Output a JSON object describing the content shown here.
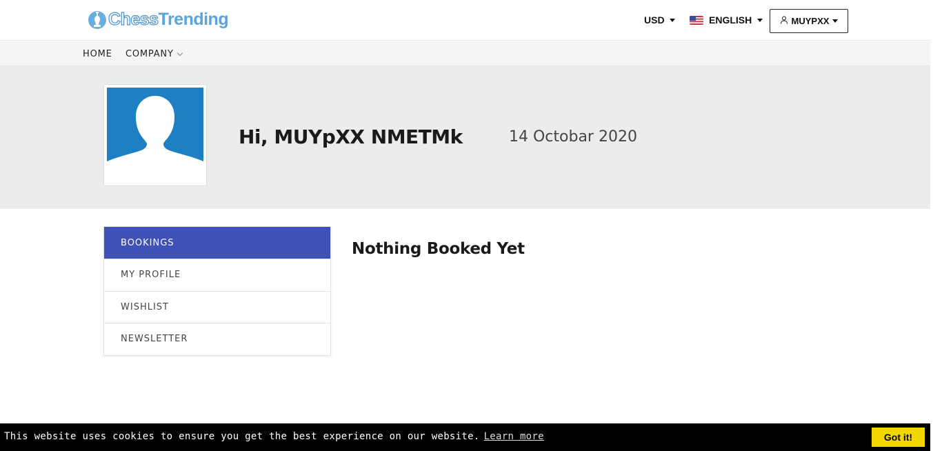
{
  "header": {
    "logo_part1": "Chess",
    "logo_part2": "Trending",
    "currency": "USD",
    "language": "ENGLISH",
    "user": "MUYPXX"
  },
  "nav": {
    "home": "HOME",
    "company": "COMPANY"
  },
  "banner": {
    "greeting": "Hi, MUYpXX NMETMk",
    "date": "14 Octobar 2020"
  },
  "sidebar": {
    "items": [
      {
        "label": "BOOKINGS"
      },
      {
        "label": "MY PROFILE"
      },
      {
        "label": "WISHLIST"
      },
      {
        "label": "NEWSLETTER"
      }
    ]
  },
  "main": {
    "empty_title": "Nothing Booked Yet"
  },
  "cookie": {
    "message": "This website uses cookies to ensure you get the best experience on our website.",
    "link": "Learn more",
    "button": "Got it!"
  },
  "colors": {
    "accent": "#3f51b5",
    "avatar_bg": "#1e7fc2",
    "cookie_button": "#f1d600"
  }
}
